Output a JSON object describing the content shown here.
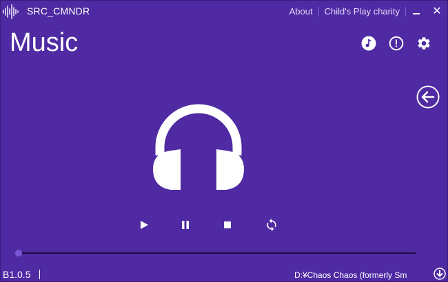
{
  "titlebar": {
    "app_title": "SRC_CMNDR",
    "links": [
      {
        "label": "About"
      },
      {
        "label": "Child's Play charity"
      }
    ],
    "minimize_icon": "minimize-icon",
    "close_icon": "close-icon",
    "close_glyph": "✕"
  },
  "main": {
    "title": "Music",
    "top_icons": [
      "music-note-icon",
      "alert-icon",
      "gear-icon"
    ],
    "back_icon": "arrow-left-icon",
    "hero_icon": "headphones-icon"
  },
  "player": {
    "controls": [
      "play-icon",
      "pause-icon",
      "stop-icon",
      "repeat-icon"
    ],
    "progress": 0
  },
  "statusbar": {
    "version": "B1.0.5",
    "file_path": "D:¥Chaos Chaos (formerly Sm",
    "download_icon": "download-icon"
  },
  "colors": {
    "background": "#4f2aa3",
    "text": "#ffffff",
    "seek_track": "#1c0f44",
    "seek_thumb": "#7a56d4"
  }
}
